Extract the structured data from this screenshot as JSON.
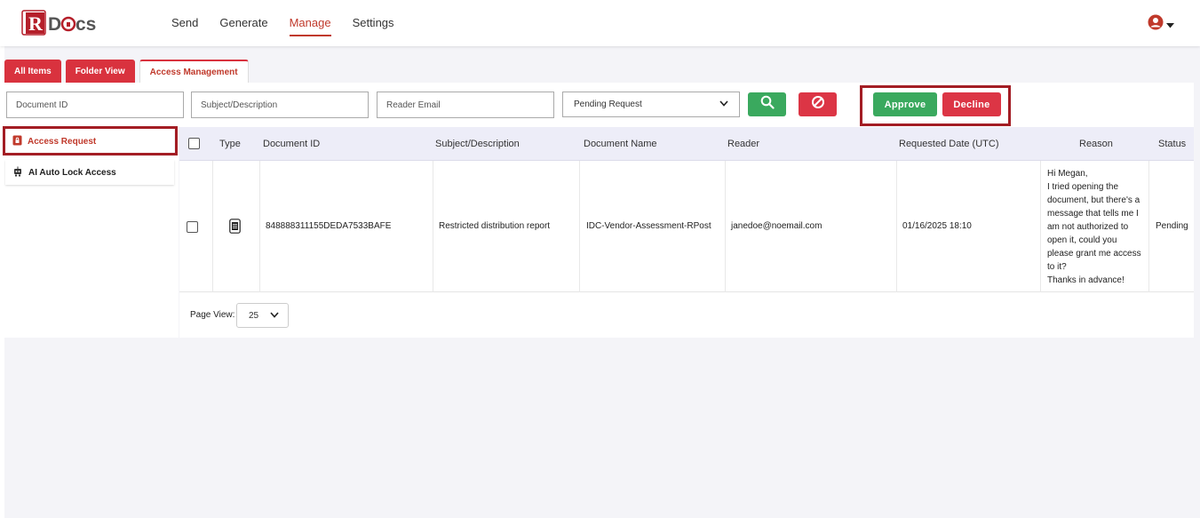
{
  "app": {
    "logo_text": "RDocs"
  },
  "nav": {
    "items": [
      "Send",
      "Generate",
      "Manage",
      "Settings"
    ],
    "active": "Manage"
  },
  "tabs": [
    {
      "label": "All Items"
    },
    {
      "label": "Folder View"
    },
    {
      "label": "Access Management"
    }
  ],
  "filters": {
    "document_id_placeholder": "Document ID",
    "subject_placeholder": "Subject/Description",
    "reader_email_placeholder": "Reader Email",
    "status_select_value": "Pending Request"
  },
  "actions": {
    "approve_label": "Approve",
    "decline_label": "Decline"
  },
  "sidebar": {
    "items": [
      {
        "label": "Access Request",
        "icon": "lock-doc-icon"
      },
      {
        "label": "AI Auto Lock Access",
        "icon": "robot-icon"
      }
    ]
  },
  "table": {
    "headers": [
      "Type",
      "Document ID",
      "Subject/Description",
      "Document Name",
      "Reader",
      "Requested Date (UTC)",
      "Reason",
      "Status"
    ],
    "rows": [
      {
        "type_icon": "document-icon",
        "document_id": "848888311155DEDA7533BAFE",
        "subject": "Restricted distribution report",
        "document_name": "IDC-Vendor-Assessment-RPost",
        "reader": "janedoe@noemail.com",
        "requested_date": "01/16/2025 18:10",
        "reason_lines": [
          "Hi Megan,",
          "I tried opening the",
          "document, but there's a",
          "message that tells me I",
          "am not authorized to",
          "open it, could you",
          "please grant me access",
          "to it?",
          "Thanks in advance!"
        ],
        "status": "Pending"
      }
    ]
  },
  "pagination": {
    "page_view_label": "Page View:",
    "page_view_value": "25"
  },
  "colors": {
    "brand_red": "#d9323e",
    "success_green": "#3aa95e",
    "highlight_border": "#a31d24",
    "header_bg": "#ededf8"
  }
}
